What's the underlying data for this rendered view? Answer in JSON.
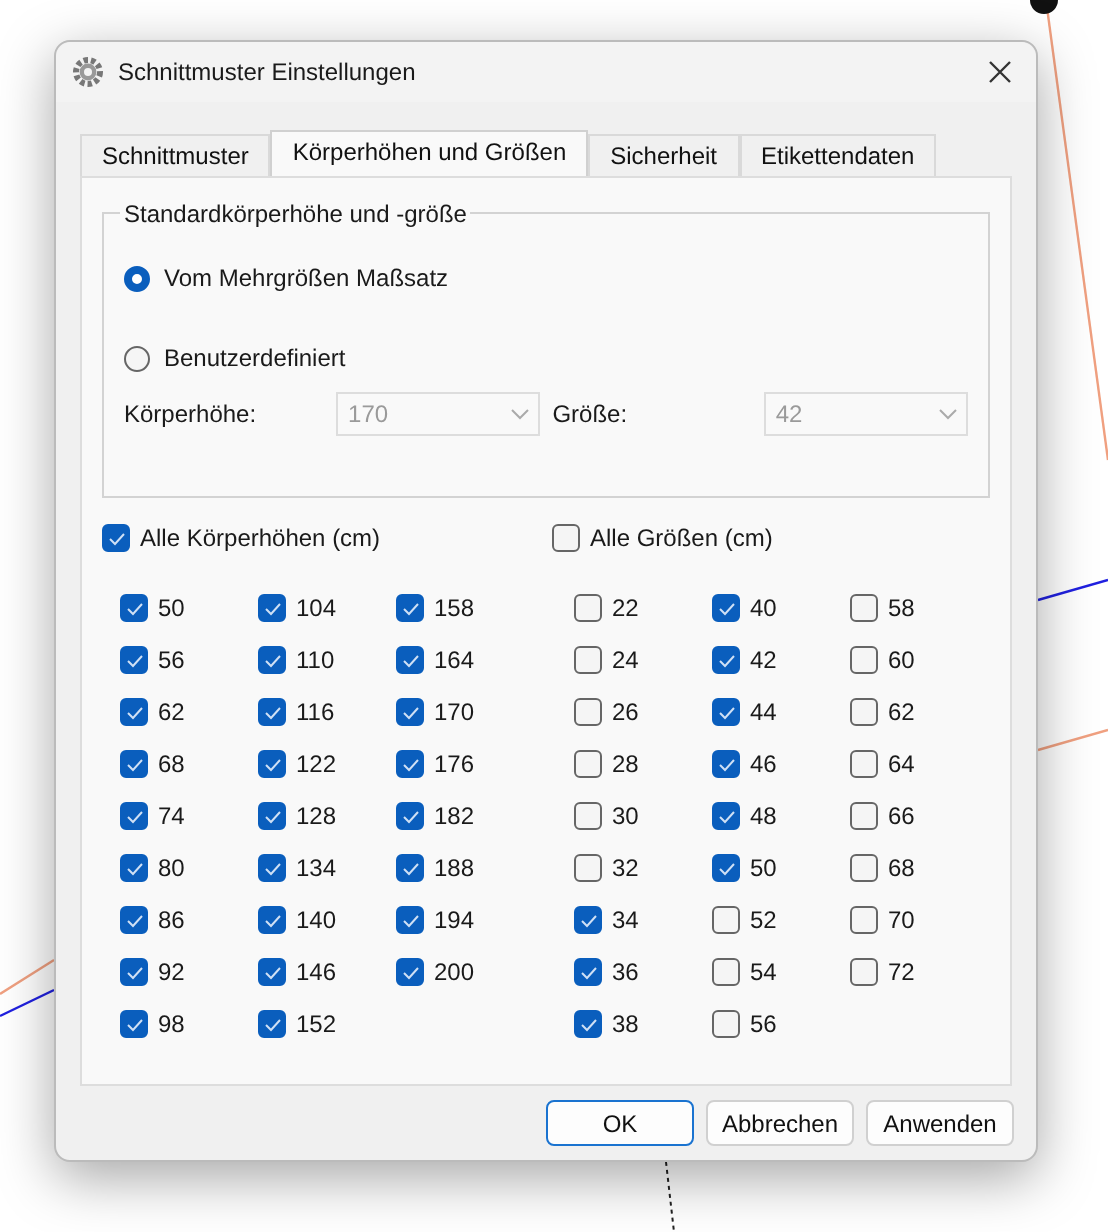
{
  "dialog": {
    "title": "Schnittmuster Einstellungen",
    "tabs": [
      {
        "label": "Schnittmuster",
        "selected": false
      },
      {
        "label": "Körperhöhen und Größen",
        "selected": true
      },
      {
        "label": "Sicherheit",
        "selected": false
      },
      {
        "label": "Etikettendaten",
        "selected": false
      }
    ],
    "group": {
      "title": "Standardkörperhöhe und -größe",
      "radios": [
        {
          "label": "Vom Mehrgrößen Maßsatz",
          "selected": true
        },
        {
          "label": "Benutzerdefiniert",
          "selected": false
        }
      ],
      "fields": [
        {
          "label": "Körperhöhe:",
          "value": "170",
          "disabled": true
        },
        {
          "label": "Größe:",
          "value": "42",
          "disabled": true
        }
      ]
    },
    "all_checks": [
      {
        "label": "Alle Körperhöhen (cm)",
        "checked": true
      },
      {
        "label": "Alle Größen (cm)",
        "checked": false
      }
    ],
    "heights": [
      {
        "label": "50",
        "checked": true
      },
      {
        "label": "56",
        "checked": true
      },
      {
        "label": "62",
        "checked": true
      },
      {
        "label": "68",
        "checked": true
      },
      {
        "label": "74",
        "checked": true
      },
      {
        "label": "80",
        "checked": true
      },
      {
        "label": "86",
        "checked": true
      },
      {
        "label": "92",
        "checked": true
      },
      {
        "label": "98",
        "checked": true
      },
      {
        "label": "104",
        "checked": true
      },
      {
        "label": "110",
        "checked": true
      },
      {
        "label": "116",
        "checked": true
      },
      {
        "label": "122",
        "checked": true
      },
      {
        "label": "128",
        "checked": true
      },
      {
        "label": "134",
        "checked": true
      },
      {
        "label": "140",
        "checked": true
      },
      {
        "label": "146",
        "checked": true
      },
      {
        "label": "152",
        "checked": true
      },
      {
        "label": "158",
        "checked": true
      },
      {
        "label": "164",
        "checked": true
      },
      {
        "label": "170",
        "checked": true
      },
      {
        "label": "176",
        "checked": true
      },
      {
        "label": "182",
        "checked": true
      },
      {
        "label": "188",
        "checked": true
      },
      {
        "label": "194",
        "checked": true
      },
      {
        "label": "200",
        "checked": true
      }
    ],
    "sizes": [
      {
        "label": "22",
        "checked": false
      },
      {
        "label": "24",
        "checked": false
      },
      {
        "label": "26",
        "checked": false
      },
      {
        "label": "28",
        "checked": false
      },
      {
        "label": "30",
        "checked": false
      },
      {
        "label": "32",
        "checked": false
      },
      {
        "label": "34",
        "checked": true
      },
      {
        "label": "36",
        "checked": true
      },
      {
        "label": "38",
        "checked": true
      },
      {
        "label": "40",
        "checked": true
      },
      {
        "label": "42",
        "checked": true
      },
      {
        "label": "44",
        "checked": true
      },
      {
        "label": "46",
        "checked": true
      },
      {
        "label": "48",
        "checked": true
      },
      {
        "label": "50",
        "checked": true
      },
      {
        "label": "52",
        "checked": false
      },
      {
        "label": "54",
        "checked": false
      },
      {
        "label": "56",
        "checked": false
      },
      {
        "label": "58",
        "checked": false
      },
      {
        "label": "60",
        "checked": false
      },
      {
        "label": "62",
        "checked": false
      },
      {
        "label": "64",
        "checked": false
      },
      {
        "label": "66",
        "checked": false
      },
      {
        "label": "68",
        "checked": false
      },
      {
        "label": "70",
        "checked": false
      },
      {
        "label": "72",
        "checked": false
      }
    ],
    "buttons": [
      {
        "label": "OK",
        "default": true
      },
      {
        "label": "Abbrechen",
        "default": false
      },
      {
        "label": "Anwenden",
        "default": false
      }
    ]
  }
}
